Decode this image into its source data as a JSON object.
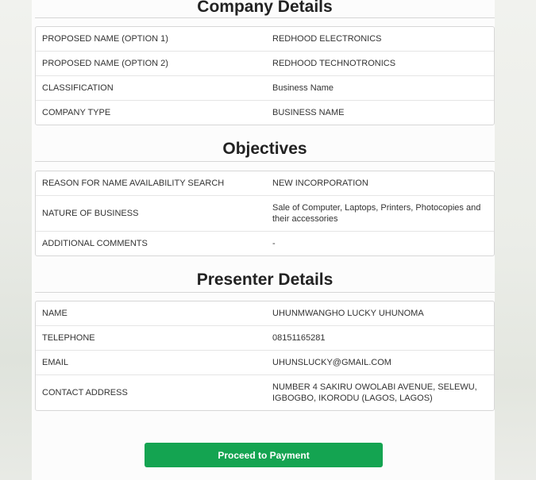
{
  "company_details": {
    "title": "Company Details",
    "rows": [
      {
        "label": "PROPOSED NAME (OPTION 1)",
        "value": "REDHOOD ELECTRONICS"
      },
      {
        "label": "PROPOSED NAME (OPTION 2)",
        "value": "REDHOOD TECHNOTRONICS"
      },
      {
        "label": "CLASSIFICATION",
        "value": "Business Name"
      },
      {
        "label": "COMPANY TYPE",
        "value": "BUSINESS NAME"
      }
    ]
  },
  "objectives": {
    "title": "Objectives",
    "rows": [
      {
        "label": "REASON FOR NAME AVAILABILITY SEARCH",
        "value": "NEW INCORPORATION"
      },
      {
        "label": "NATURE OF BUSINESS",
        "value": "Sale of Computer, Laptops, Printers, Photocopies and their accessories"
      },
      {
        "label": "ADDITIONAL COMMENTS",
        "value": "-"
      }
    ]
  },
  "presenter_details": {
    "title": "Presenter Details",
    "rows": [
      {
        "label": "NAME",
        "value": "UHUNMWANGHO LUCKY UHUNOMA"
      },
      {
        "label": "TELEPHONE",
        "value": "08151165281"
      },
      {
        "label": "EMAIL",
        "value": "UHUNSLUCKY@GMAIL.COM"
      },
      {
        "label": "CONTACT ADDRESS",
        "value": "NUMBER 4 SAKIRU OWOLABI AVENUE, SELEWU, IGBOGBO, IKORODU (LAGOS, LAGOS)"
      }
    ]
  },
  "actions": {
    "proceed_label": "Proceed to Payment"
  },
  "colors": {
    "button_green": "#14a451"
  }
}
